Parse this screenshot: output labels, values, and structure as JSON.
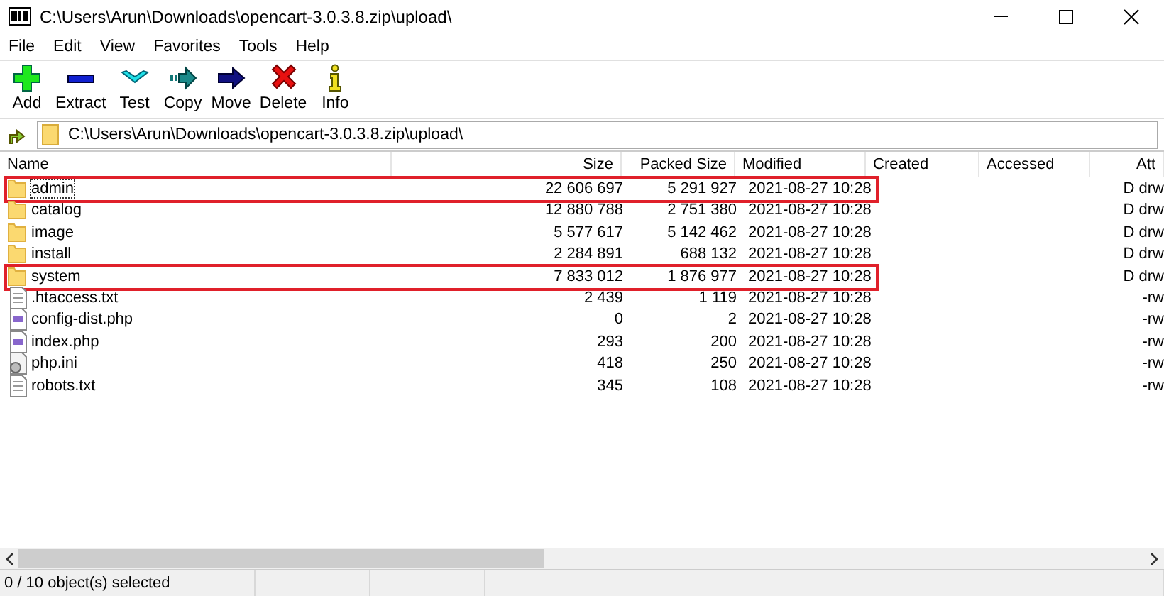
{
  "window": {
    "title": "C:\\Users\\Arun\\Downloads\\opencart-3.0.3.8.zip\\upload\\"
  },
  "menu": [
    "File",
    "Edit",
    "View",
    "Favorites",
    "Tools",
    "Help"
  ],
  "toolbar": [
    "Add",
    "Extract",
    "Test",
    "Copy",
    "Move",
    "Delete",
    "Info"
  ],
  "address": {
    "value": "C:\\Users\\Arun\\Downloads\\opencart-3.0.3.8.zip\\upload\\"
  },
  "table": {
    "columns": [
      "Name",
      "Size",
      "Packed Size",
      "Modified",
      "Created",
      "Accessed",
      "Att"
    ],
    "rows": [
      {
        "kind": "folder",
        "name": "admin",
        "size": "22 606 697",
        "packed": "5 291 927",
        "modified": "2021-08-27 10:28",
        "attributes": "D drw",
        "focused": true,
        "highlighted": true
      },
      {
        "kind": "folder",
        "name": "catalog",
        "size": "12 880 788",
        "packed": "2 751 380",
        "modified": "2021-08-27 10:28",
        "attributes": "D drw",
        "focused": false,
        "highlighted": false
      },
      {
        "kind": "folder",
        "name": "image",
        "size": "5 577 617",
        "packed": "5 142 462",
        "modified": "2021-08-27 10:28",
        "attributes": "D drw",
        "focused": false,
        "highlighted": false
      },
      {
        "kind": "folder",
        "name": "install",
        "size": "2 284 891",
        "packed": "688 132",
        "modified": "2021-08-27 10:28",
        "attributes": "D drw",
        "focused": false,
        "highlighted": false
      },
      {
        "kind": "folder",
        "name": "system",
        "size": "7 833 012",
        "packed": "1 876 977",
        "modified": "2021-08-27 10:28",
        "attributes": "D drw",
        "focused": false,
        "highlighted": true
      },
      {
        "kind": "text",
        "name": ".htaccess.txt",
        "size": "2 439",
        "packed": "1 119",
        "modified": "2021-08-27 10:28",
        "attributes": "-rw",
        "focused": false,
        "highlighted": false
      },
      {
        "kind": "script",
        "name": "config-dist.php",
        "size": "0",
        "packed": "2",
        "modified": "2021-08-27 10:28",
        "attributes": "-rw",
        "focused": false,
        "highlighted": false
      },
      {
        "kind": "script",
        "name": "index.php",
        "size": "293",
        "packed": "200",
        "modified": "2021-08-27 10:28",
        "attributes": "-rw",
        "focused": false,
        "highlighted": false
      },
      {
        "kind": "settings",
        "name": "php.ini",
        "size": "418",
        "packed": "250",
        "modified": "2021-08-27 10:28",
        "attributes": "-rw",
        "focused": false,
        "highlighted": false
      },
      {
        "kind": "text",
        "name": "robots.txt",
        "size": "345",
        "packed": "108",
        "modified": "2021-08-27 10:28",
        "attributes": "-rw",
        "focused": false,
        "highlighted": false
      }
    ]
  },
  "status_bar": {
    "text": "0 / 10 object(s) selected"
  }
}
